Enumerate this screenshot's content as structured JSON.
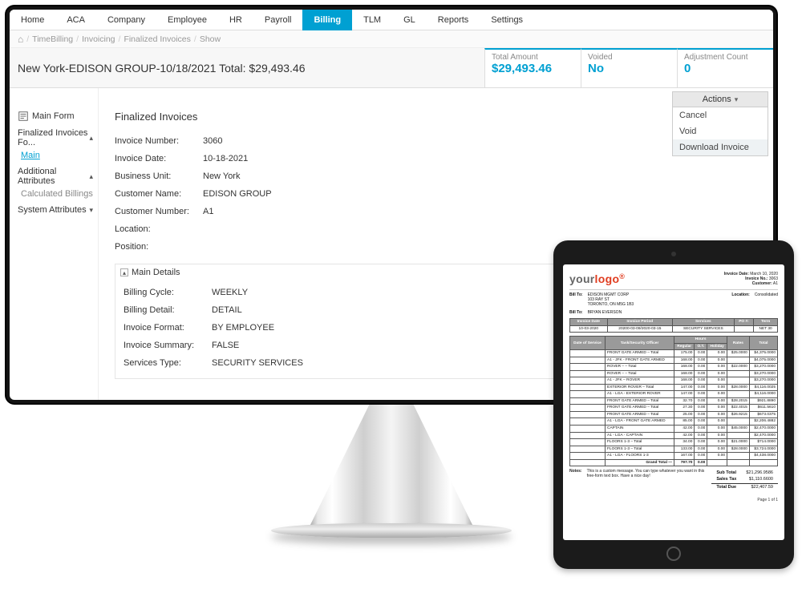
{
  "nav": [
    "Home",
    "ACA",
    "Company",
    "Employee",
    "HR",
    "Payroll",
    "Billing",
    "TLM",
    "GL",
    "Reports",
    "Settings"
  ],
  "nav_active_index": 6,
  "breadcrumb": [
    "TimeBilling",
    "Invoicing",
    "Finalized Invoices",
    "Show"
  ],
  "page_title": "New York-EDISON GROUP-10/18/2021 Total: $29,493.46",
  "stats": [
    {
      "label": "Total Amount",
      "value": "$29,493.46"
    },
    {
      "label": "Voided",
      "value": "No"
    },
    {
      "label": "Adjustment Count",
      "value": "0"
    }
  ],
  "actions": {
    "button": "Actions",
    "items": [
      "Cancel",
      "Void",
      "Download Invoice"
    ],
    "hover_index": 2
  },
  "sidebar": {
    "title": "Main Form",
    "groups": [
      {
        "label": "Finalized Invoices Fo...",
        "open": true,
        "items": [
          {
            "label": "Main",
            "link": true
          }
        ]
      },
      {
        "label": "Additional Attributes",
        "open": true,
        "items": [
          {
            "label": "Calculated Billings",
            "link": false
          }
        ]
      },
      {
        "label": "System Attributes",
        "open": false,
        "items": []
      }
    ]
  },
  "main": {
    "section_title": "Finalized Invoices",
    "fields": [
      {
        "label": "Invoice Number:",
        "value": "3060"
      },
      {
        "label": "Invoice Date:",
        "value": "10-18-2021"
      },
      {
        "label": "Business Unit:",
        "value": "New York"
      },
      {
        "label": "Customer Name:",
        "value": "EDISON GROUP"
      },
      {
        "label": "Customer Number:",
        "value": "A1"
      },
      {
        "label": "Location:",
        "value": ""
      },
      {
        "label": "Position:",
        "value": ""
      }
    ],
    "subsection": {
      "title": "Main Details",
      "fields": [
        {
          "label": "Billing Cycle:",
          "value": "WEEKLY"
        },
        {
          "label": "Billing Detail:",
          "value": "DETAIL"
        },
        {
          "label": "Invoice Format:",
          "value": "BY EMPLOYEE"
        },
        {
          "label": "Invoice Summary:",
          "value": "FALSE"
        },
        {
          "label": "Services Type:",
          "value": "SECURITY SERVICES"
        }
      ]
    }
  },
  "invoice": {
    "logo": {
      "a": "your",
      "b": "logo",
      "reg": "®"
    },
    "meta": [
      {
        "k": "Invoice Date:",
        "v": "March 10, 2020"
      },
      {
        "k": "Invoice No.:",
        "v": "3063"
      },
      {
        "k": "Customer:",
        "v": "A1"
      }
    ],
    "billto": {
      "label": "Bill To:",
      "name": "EDISON MGMT CORP",
      "line1": "103 RAY ST",
      "line2": "TORONTO, ON M5G 1B3"
    },
    "location": {
      "label": "Location:",
      "value": "Consolidated"
    },
    "billto2": {
      "label": "Bill To:",
      "name": "BRYAN EVERSON"
    },
    "header_row": [
      "Invoice Date",
      "Invoice Period",
      "Services",
      "PO #:",
      "Term"
    ],
    "header_vals": [
      "10-03-2020",
      "20200-03-09/2020-03-15",
      "SECURITY SERVICES",
      "",
      "NET 30"
    ],
    "cols_row": [
      "Date of Service",
      "Task/Security Officer",
      "Hours",
      "",
      "",
      "Rates",
      "Total"
    ],
    "cols_sub": [
      "",
      "",
      "Regular",
      "O.T.",
      "Holiday",
      "",
      ""
    ],
    "rows": [
      [
        "",
        "FRONT GATE ARMED – Total",
        "175.00",
        "0.00",
        "0.00",
        "$25.0000",
        "$4,375.0000"
      ],
      [
        "",
        "A1 - JFK - FRONT GATE ARMED",
        "168.00",
        "0.00",
        "0.00",
        "",
        "$4,075.0000"
      ],
      [
        "",
        "ROVER – – Total",
        "168.00",
        "0.00",
        "0.00",
        "$22.0000",
        "$3,270.0000"
      ],
      [
        "",
        "ROVER – – Total",
        "168.00",
        "0.00",
        "0.00",
        "",
        "$3,270.0000"
      ],
      [
        "",
        "A1 - JFK – ROVER",
        "168.00",
        "0.00",
        "0.00",
        "",
        "$3,270.0000"
      ],
      [
        "",
        "EXTERIOR ROVER – Total",
        "147.00",
        "0.00",
        "0.00",
        "$28.0000",
        "$4,116.0025"
      ],
      [
        "",
        "A1 - LGA - EXTERIOR ROVER",
        "147.00",
        "0.00",
        "0.00",
        "",
        "$4,116.0000"
      ],
      [
        "",
        "FRONT GATE ARMED – Total",
        "32.70",
        "0.00",
        "0.00",
        "$28.2015",
        "$921.8890"
      ],
      [
        "",
        "FRONT GATE ARMED – Total",
        "27.30",
        "0.00",
        "0.00",
        "$22.4015",
        "$611.5610"
      ],
      [
        "",
        "FRONT GATE ARMED – Total",
        "25.00",
        "0.00",
        "0.00",
        "$26.9215",
        "$673.0375"
      ],
      [
        "",
        "A1 - LGA - FRONT GATE ARMED",
        "85.00",
        "0.00",
        "0.00",
        "",
        "$2,206.4882"
      ],
      [
        "",
        "CAPTAIN",
        "42.00",
        "0.00",
        "0.00",
        "$45.0000",
        "$2,470.0000"
      ],
      [
        "",
        "A1 - LGA - CAPTAIN",
        "42.00",
        "0.00",
        "0.00",
        "",
        "$2,470.0000"
      ],
      [
        "",
        "FLOORS 1-3 – Total",
        "34.00",
        "0.00",
        "0.00",
        "$21.0000",
        "$714.0000"
      ],
      [
        "",
        "FLOORS 1-3 – Total",
        "133.00",
        "0.00",
        "0.00",
        "$28.0000",
        "$3,724.0000"
      ],
      [
        "",
        "A1 - LGA - FLOORS 1-3",
        "167.00",
        "0.00",
        "0.00",
        "",
        "$4,438.0000"
      ]
    ],
    "grand": {
      "label": "Grand Total —",
      "hrs": "797.70",
      "ot": "0.00"
    },
    "totals": [
      {
        "k": "Sub Total",
        "v": "$21,296.9586"
      },
      {
        "k": "Sales Tax",
        "v": "$1,110.6600"
      },
      {
        "k": "Total Due",
        "v": "$22,407.59"
      }
    ],
    "notes": {
      "label": "Notes:",
      "text": "This is a custom message. You can type whatever you want in this free-form text box. Have a nice day!"
    },
    "page": "Page 1 of 1"
  }
}
